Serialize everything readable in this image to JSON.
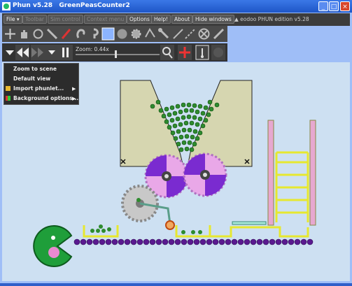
{
  "window": {
    "title": "Phun v5.28   GreenPeasCounter2"
  },
  "menu": {
    "file": "File ▾",
    "toolbar": "Toolbar",
    "sim_control": "Sim control",
    "context_menu": "Context menu",
    "options": "Options",
    "help": "Help!",
    "about": "About",
    "hide_windows": "Hide windows",
    "edition": "▲ eodoo PHUN edition v5.28"
  },
  "sim": {
    "zoom_label": "Zoom: 0.44x",
    "zoom": 0.44
  },
  "context_menu": {
    "items": [
      "Zoom to scene",
      "Default view",
      "Import phunlet...",
      "Background options..."
    ],
    "submenu_arrow": "▶"
  },
  "colors": {
    "sky": "#cde0f2",
    "funnel": "#d6d6b0",
    "peas": "#2e8b2e",
    "purple": "#7a2bd0",
    "ball_pit": "#5a1a90",
    "yellow_track": "#e6e830",
    "pink_pillar": "#e7a8d0",
    "pacman": "#1f9e3a"
  }
}
